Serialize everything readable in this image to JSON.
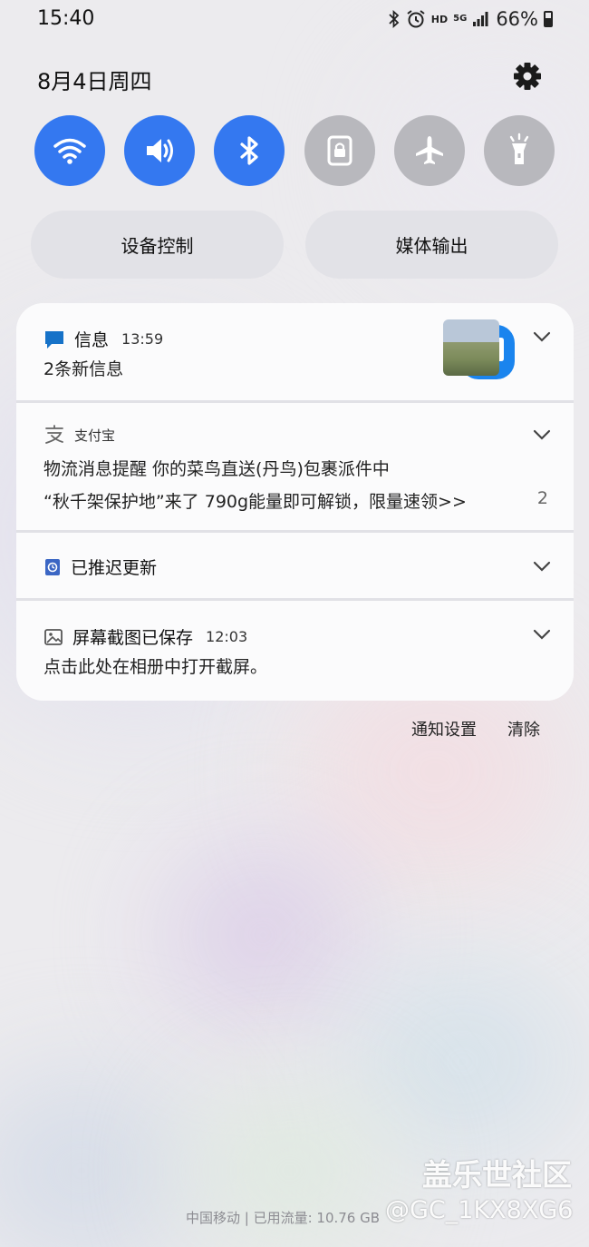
{
  "status_bar": {
    "time": "15:40",
    "hd": "HD",
    "network": "5G",
    "battery_pct": "66%",
    "icons": [
      "bluetooth-icon",
      "alarm-icon",
      "signal-icon",
      "battery-icon"
    ]
  },
  "date": "8月4日周四",
  "quick_settings": [
    {
      "name": "wifi",
      "icon": "wifi-icon",
      "state": "on"
    },
    {
      "name": "sound",
      "icon": "volume-icon",
      "state": "on"
    },
    {
      "name": "bluetooth",
      "icon": "bluetooth-icon",
      "state": "on"
    },
    {
      "name": "rotation-lock",
      "icon": "lock-icon",
      "state": "off"
    },
    {
      "name": "airplane",
      "icon": "airplane-icon",
      "state": "off"
    },
    {
      "name": "flashlight",
      "icon": "flashlight-icon",
      "state": "off"
    }
  ],
  "pills": {
    "device_control": "设备控制",
    "media_output": "媒体输出"
  },
  "notifications": {
    "messages": {
      "app": "信息",
      "time": "13:59",
      "text": "2条新信息"
    },
    "alipay": {
      "app": "支付宝",
      "line1": "物流消息提醒 你的菜鸟直送(丹鸟)包裹派件中",
      "line2": "“秋千架保护地”来了 790g能量即可解锁，限量速领>>",
      "count": "2"
    },
    "update": {
      "text": "已推迟更新"
    },
    "screenshot": {
      "app": "屏幕截图已保存",
      "time": "12:03",
      "text": "点击此处在相册中打开截屏。"
    }
  },
  "actions": {
    "notif_settings": "通知设置",
    "clear": "清除"
  },
  "footer": {
    "carrier": "中国移动 | 已用流量: 10.76 GB"
  },
  "watermark": {
    "line1": "盖乐世社区",
    "line2": "@GC_1KX8XG6"
  },
  "colors": {
    "accent": "#3478f0",
    "toggle_off": "#b8b8bd",
    "message_blue": "#1a84ee"
  }
}
